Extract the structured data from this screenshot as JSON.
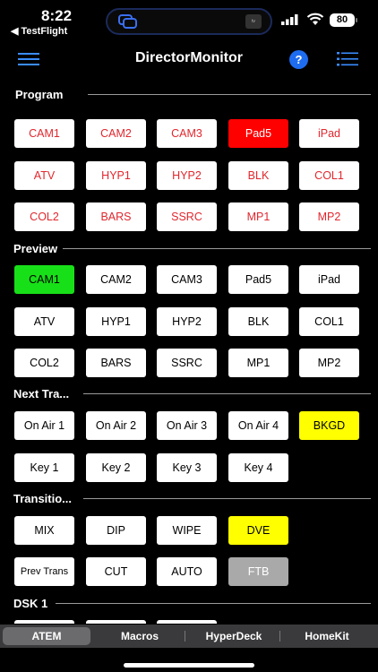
{
  "status": {
    "time": "8:22",
    "back_label": "◀ TestFlight",
    "battery": "80",
    "island_right_label": "tv"
  },
  "nav": {
    "title": "DirectorMonitor",
    "help_label": "?"
  },
  "sections": {
    "program": {
      "title": "Program",
      "rows": [
        [
          "CAM1",
          "CAM2",
          "CAM3",
          "Pad5",
          "iPad"
        ],
        [
          "ATV",
          "HYP1",
          "HYP2",
          "BLK",
          "COL1"
        ],
        [
          "COL2",
          "BARS",
          "SSRC",
          "MP1",
          "MP2"
        ]
      ],
      "selected": "Pad5"
    },
    "preview": {
      "title": "Preview",
      "rows": [
        [
          "CAM1",
          "CAM2",
          "CAM3",
          "Pad5",
          "iPad"
        ],
        [
          "ATV",
          "HYP1",
          "HYP2",
          "BLK",
          "COL1"
        ],
        [
          "COL2",
          "BARS",
          "SSRC",
          "MP1",
          "MP2"
        ]
      ],
      "selected": "CAM1"
    },
    "next_transition": {
      "title": "Next Tra...",
      "rows": [
        [
          "On Air 1",
          "On Air 2",
          "On Air 3",
          "On Air 4",
          "BKGD"
        ],
        [
          "Key 1",
          "Key 2",
          "Key 3",
          "Key 4"
        ]
      ],
      "selected": "BKGD"
    },
    "transition": {
      "title": "Transitio...",
      "rows": [
        [
          "MIX",
          "DIP",
          "WIPE",
          "DVE"
        ],
        [
          "Prev Trans",
          "CUT",
          "AUTO",
          "FTB"
        ]
      ],
      "selected": "DVE",
      "disabled": "FTB"
    },
    "dsk1": {
      "title": "DSK 1"
    }
  },
  "tabs": [
    {
      "label": "ATEM",
      "active": true
    },
    {
      "label": "Macros",
      "active": false
    },
    {
      "label": "HyperDeck",
      "active": false
    },
    {
      "label": "HomeKit",
      "active": false
    }
  ],
  "colors": {
    "program_text": "#e0272e",
    "program_active": "#ff0000",
    "preview_active": "#18e018",
    "selected_yellow": "#ffff00",
    "disabled_gray": "#a9a9a9",
    "help_blue": "#1e6cf0"
  }
}
